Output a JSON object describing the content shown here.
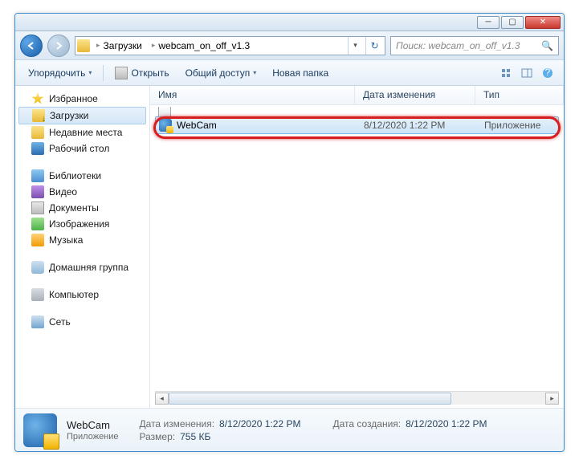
{
  "titlebar": {
    "min": "─",
    "max": "▢",
    "close": "✕"
  },
  "nav": {
    "folder_icon": "folder-icon",
    "segments": [
      "Загрузки",
      "webcam_on_off_v1.3"
    ],
    "sep": "▸",
    "dropdown": "▾",
    "refresh": "↻"
  },
  "search": {
    "placeholder": "Поиск: webcam_on_off_v1.3",
    "icon": "🔍"
  },
  "toolbar": {
    "organize": "Упорядочить",
    "open": "Открыть",
    "share": "Общий доступ",
    "newfolder": "Новая папка",
    "dd": "▾"
  },
  "tree": {
    "favorites": "Избранное",
    "downloads": "Загрузки",
    "recent": "Недавние места",
    "desktop": "Рабочий стол",
    "libraries": "Библиотеки",
    "videos": "Видео",
    "documents": "Документы",
    "pictures": "Изображения",
    "music": "Музыка",
    "homegroup": "Домашняя группа",
    "computer": "Компьютер",
    "network": "Сеть"
  },
  "columns": {
    "name": "Имя",
    "date": "Дата изменения",
    "type": "Тип"
  },
  "files": [
    {
      "name": "WebCam",
      "date": "8/12/2020 1:22 PM",
      "type": "Приложение",
      "selected": true
    }
  ],
  "details": {
    "name": "WebCam",
    "type": "Приложение",
    "props": {
      "modified_k": "Дата изменения:",
      "modified_v": "8/12/2020 1:22 PM",
      "size_k": "Размер:",
      "size_v": "755 КБ",
      "created_k": "Дата создания:",
      "created_v": "8/12/2020 1:22 PM"
    }
  },
  "scroll": {
    "left": "◂",
    "right": "▸"
  }
}
